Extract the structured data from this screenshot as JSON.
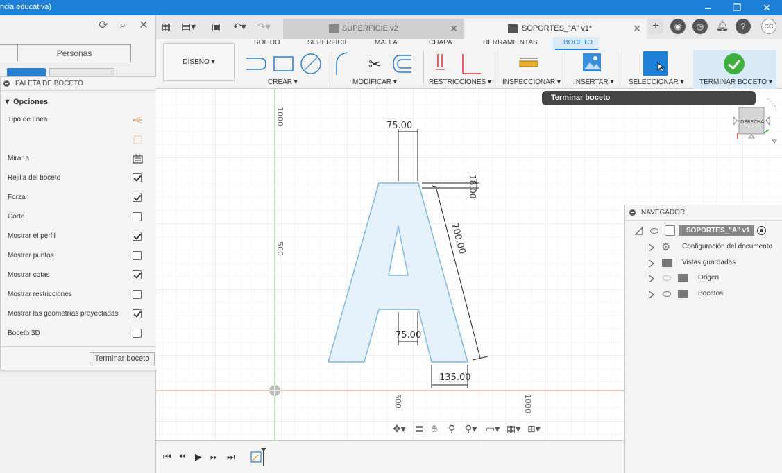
{
  "window": {
    "title": "ncia educativa)",
    "minimize": "–",
    "restore": "❐",
    "close": "✕"
  },
  "data_panel": {
    "tab_people": "Personas"
  },
  "sketch_palette": {
    "title": "PALETA DE BOCETO",
    "section": "▼ Opciones",
    "options": [
      {
        "label": "Tipo de línea",
        "control": "icon"
      },
      {
        "label": "",
        "control": "icon"
      },
      {
        "label": "Mirar a",
        "control": "icon"
      },
      {
        "label": "Rejilla del boceto",
        "control": "checkbox",
        "checked": true
      },
      {
        "label": "Forzar",
        "control": "checkbox",
        "checked": true
      },
      {
        "label": "Corte",
        "control": "checkbox",
        "checked": false
      },
      {
        "label": "Mostrar el perfil",
        "control": "checkbox",
        "checked": true
      },
      {
        "label": "Mostrar puntos",
        "control": "checkbox",
        "checked": false
      },
      {
        "label": "Mostrar cotas",
        "control": "checkbox",
        "checked": true
      },
      {
        "label": "Mostrar restricciones",
        "control": "checkbox",
        "checked": false
      },
      {
        "label": "Mostrar las geometrías proyectadas",
        "control": "checkbox",
        "checked": true
      },
      {
        "label": "Boceto 3D",
        "control": "checkbox",
        "checked": false
      }
    ],
    "finish_button": "Terminar boceto"
  },
  "doc_tabs": [
    {
      "name": "SUPERFICIE v2",
      "active": false
    },
    {
      "name": "SOPORTES_\"A\" v1*",
      "active": true
    }
  ],
  "user_initials": "CC",
  "ribbon": {
    "tabs": [
      "SOLIDO",
      "SUPERFICIE",
      "MALLA",
      "CHAPA",
      "HERRAMIENTAS",
      "BOCETO"
    ],
    "active_tab": "BOCETO",
    "workspace": "DISEÑO ▾",
    "groups": [
      "CREAR ▾",
      "MODIFICAR ▾",
      "RESTRICCIONES ▾",
      "INSPECCIONAR ▾",
      "INSERTAR ▾",
      "SELECCIONAR ▾",
      "TERMINAR BOCETO ▾"
    ]
  },
  "tooltip": "Terminar boceto",
  "viewcube_label": "DERECHA",
  "sketch": {
    "axis_labels": [
      "1000",
      "500",
      "500",
      "1000"
    ],
    "dimensions": [
      "75.00",
      "18.00",
      "700.00",
      "75.00",
      "135.00"
    ]
  },
  "navigator": {
    "title": "NAVEGADOR",
    "root": "SOPORTES_\"A\" v1",
    "items": [
      "Configuración del documento",
      "Vistas guardadas",
      "Origen",
      "Bocetos"
    ]
  },
  "colors": {
    "accent": "#1e7fd6",
    "sketch_line": "#7fb8e0",
    "sketch_fill": "#e6f1fa",
    "finish_green": "#3fb03f",
    "axis_green": "#8fd08f",
    "axis_red": "#e8a08a"
  }
}
